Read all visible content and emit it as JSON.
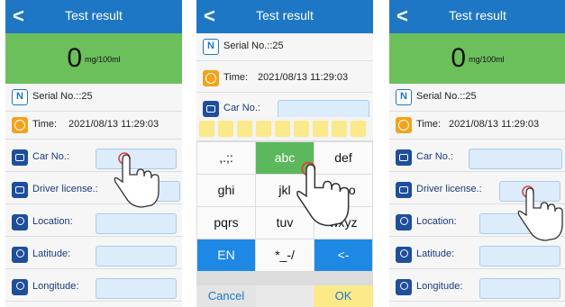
{
  "screens": [
    {
      "title": "Test result",
      "reading_value": "0",
      "reading_unit": "mg/100ml",
      "serial": "Serial No.::25",
      "time_label": "Time:",
      "time_value": "2021/08/13 11:29:03",
      "car_no": "Car No.:",
      "driver_license": "Driver license.:",
      "location": "Location:",
      "latitude": "Latitude:",
      "longitude": "Longitude:"
    },
    {
      "title": "Test result",
      "serial": "Serial No.::25",
      "time_label": "Time:",
      "time_value": "2021/08/13 11:29:03",
      "car_no_partial": "Car No.:",
      "keys": {
        "k1": ",.;:",
        "k2": "abc",
        "k3": "def",
        "k4": "ghi",
        "k5": "jkl",
        "k6": "mno",
        "k7": "pqrs",
        "k8": "tuv",
        "k9": "wxyz",
        "k_mode": "EN",
        "k_sym": "*_-/",
        "k_back": "<-"
      },
      "cancel": "Cancel",
      "ok": "OK"
    },
    {
      "title": "Test result",
      "reading_value": "0",
      "reading_unit": "mg/100ml",
      "serial": "Serial No.::25",
      "time_label": "Time:",
      "time_value": "2021/08/13 11:29:03",
      "car_no": "Car No.:",
      "driver_license": "Driver license.:",
      "location": "Location:",
      "latitude": "Latitude:",
      "longitude": "Longitude:"
    }
  ],
  "colors": {
    "header_blue": "#1e77c5",
    "reading_green": "#6cc05c",
    "field_blue": "#dcecfa",
    "key_green": "#5cb85c",
    "key_blue": "#1e88e5",
    "candidate_yellow": "#fbe98a"
  },
  "icons": [
    "back-arrow-icon",
    "serial-icon",
    "clock-icon",
    "car-icon",
    "id-card-icon",
    "location-pin-icon",
    "hand-pointer-icon"
  ]
}
